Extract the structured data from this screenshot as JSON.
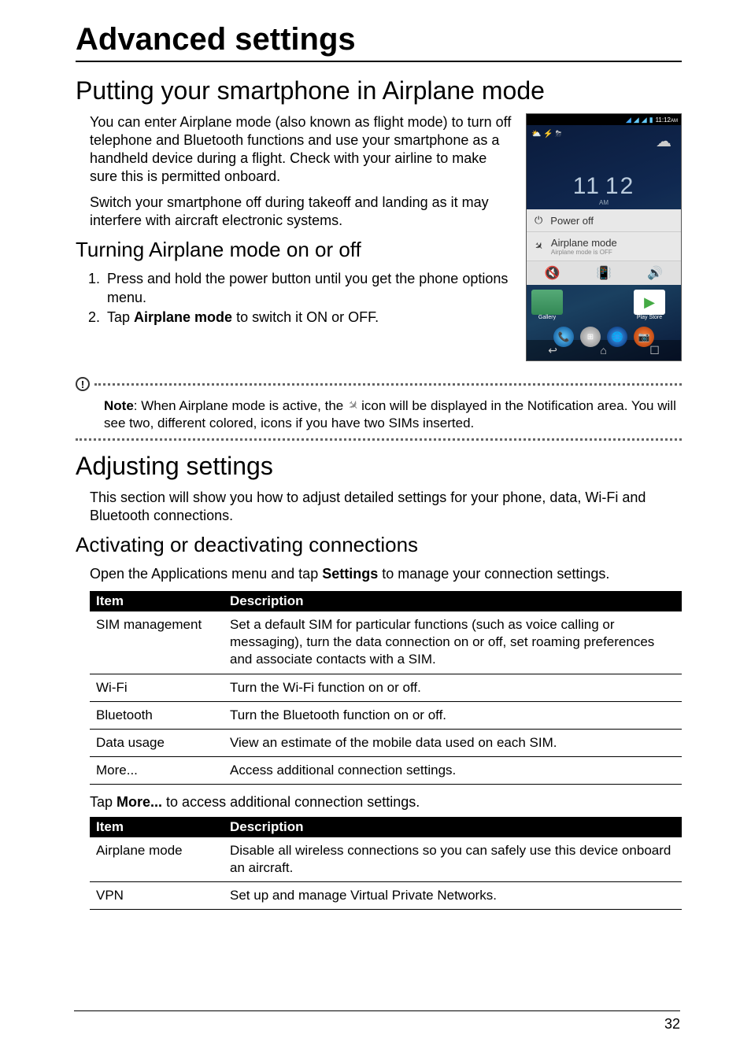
{
  "chapter_title": "Advanced settings",
  "section1": {
    "title": "Putting your smartphone in Airplane mode",
    "p1": "You can enter Airplane mode (also known as flight mode) to turn off telephone and Bluetooth functions and use your smartphone as a handheld device during a flight. Check with your airline to make sure this is permitted onboard.",
    "p2": "Switch your smartphone off during takeoff and landing as it may interfere with aircraft electronic systems.",
    "subsection": "Turning Airplane mode on or off",
    "step1": "Press and hold the power button until you get the phone options menu.",
    "step2_pre": "Tap ",
    "step2_bold": "Airplane mode",
    "step2_post": " to switch it ON or OFF."
  },
  "phone": {
    "status_time": "11:12",
    "status_am_suffix": "AM",
    "clock_h": "11",
    "clock_m": "12",
    "clock_am": "AM",
    "menu_power": "Power off",
    "menu_airplane": "Airplane mode",
    "menu_airplane_sub": "Airplane mode is OFF",
    "app_label_left": "Gallery",
    "app_label_right": "Play Store"
  },
  "note": {
    "prefix": "Note",
    "text_pre": ": When Airplane mode is active, the ",
    "text_post": " icon will be displayed in the Notification area. You will see two, different colored, icons if you have two SIMs inserted."
  },
  "section2": {
    "title": "Adjusting settings",
    "p1": "This section will show you how to adjust detailed settings for your phone, data, Wi-Fi and Bluetooth connections.",
    "subsection": "Activating or deactivating connections",
    "p2_pre": "Open the Applications menu and tap ",
    "p2_bold": "Settings",
    "p2_post": " to manage your connection settings."
  },
  "table1": {
    "h1": "Item",
    "h2": "Description",
    "rows": [
      {
        "item": "SIM management",
        "desc": "Set a default SIM for particular functions (such as voice calling or messaging), turn the data connection on or off, set roaming preferences and associate contacts with a SIM."
      },
      {
        "item": "Wi-Fi",
        "desc": "Turn the Wi-Fi function on or off."
      },
      {
        "item": "Bluetooth",
        "desc": "Turn the Bluetooth function on or off."
      },
      {
        "item": "Data usage",
        "desc": "View an estimate of the mobile data used on each SIM."
      },
      {
        "item": "More...",
        "desc": "Access additional connection settings."
      }
    ]
  },
  "tap_more_pre": "Tap ",
  "tap_more_bold": "More...",
  "tap_more_post": " to access additional connection settings.",
  "table2": {
    "h1": "Item",
    "h2": "Description",
    "rows": [
      {
        "item": "Airplane mode",
        "desc": "Disable all wireless connections so you can safely use this device onboard an aircraft."
      },
      {
        "item": "VPN",
        "desc": "Set up and manage Virtual Private Networks."
      }
    ]
  },
  "page_number": "32"
}
